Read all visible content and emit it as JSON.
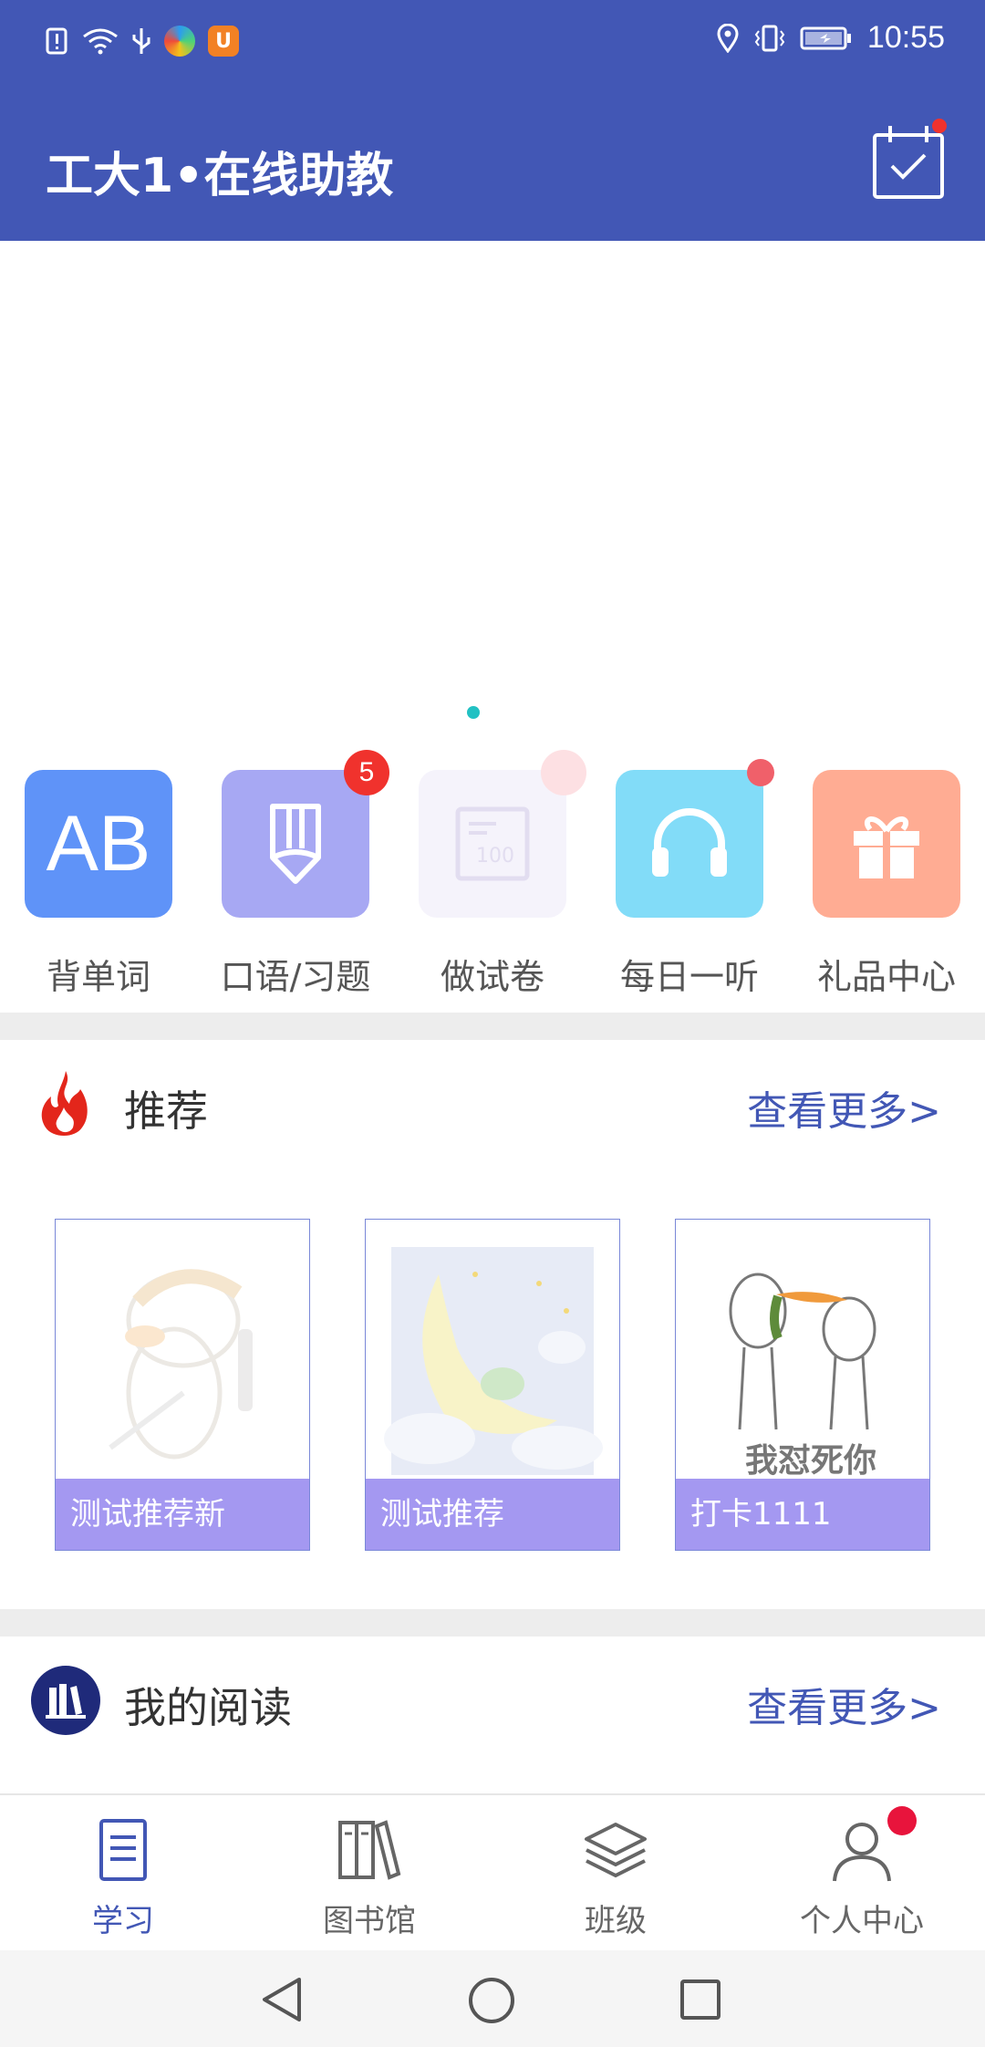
{
  "status_bar": {
    "time": "10:55"
  },
  "header": {
    "title": "工大1•在线助教"
  },
  "features": [
    {
      "label": "背单词",
      "tile_text": "AB",
      "color": "#5f93f8"
    },
    {
      "label": "口语/习题",
      "badge": "5",
      "color": "#a7a8f3"
    },
    {
      "label": "做试卷",
      "color": "#f5f3fb"
    },
    {
      "label": "每日一听",
      "color": "#82dcf8"
    },
    {
      "label": "礼品中心",
      "color": "#ffac93"
    }
  ],
  "recommend": {
    "title": "推荐",
    "more": "查看更多>",
    "cards": [
      {
        "caption": "测试推荐新"
      },
      {
        "caption": "测试推荐"
      },
      {
        "caption": "打卡1111",
        "art_text": "我怼死你"
      }
    ]
  },
  "reading": {
    "title": "我的阅读",
    "more": "查看更多>"
  },
  "bottom_nav": [
    {
      "label": "学习",
      "active": true
    },
    {
      "label": "图书馆"
    },
    {
      "label": "班级"
    },
    {
      "label": "个人中心"
    }
  ],
  "colors": {
    "primary": "#4257b5",
    "badge": "#f0322d",
    "caption_bg": "#9486ee"
  }
}
